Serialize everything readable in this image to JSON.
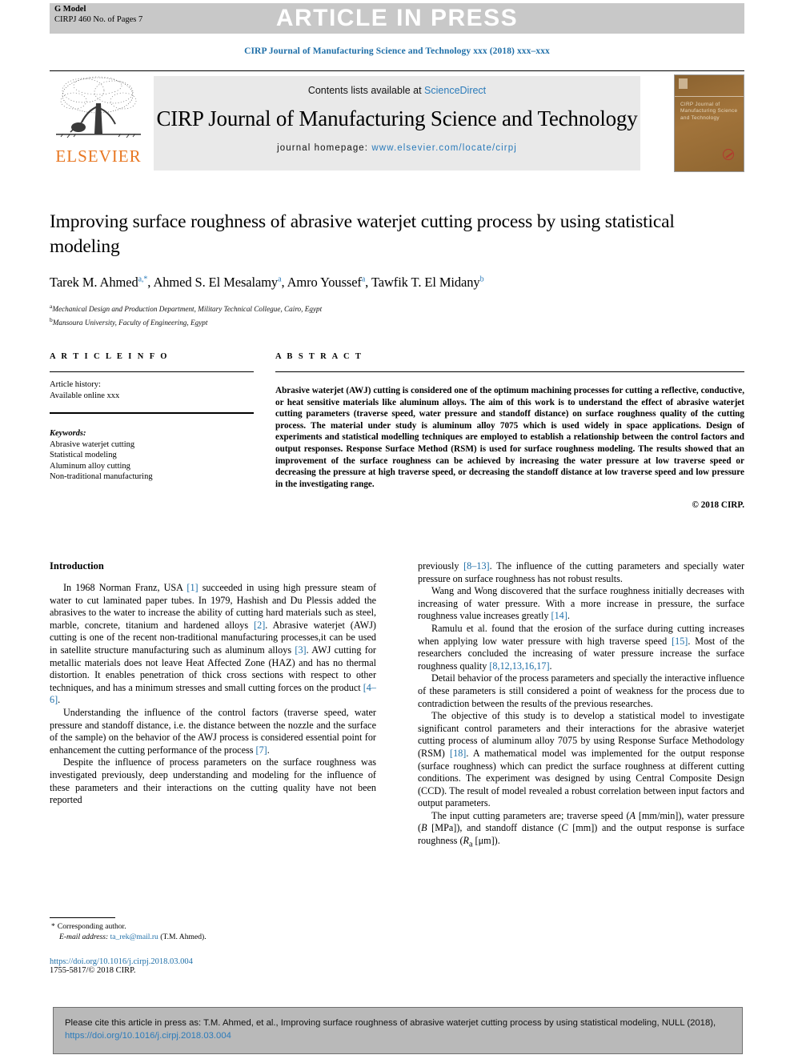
{
  "header": {
    "g_model_line1": "G Model",
    "g_model_line2": "CIRPJ 460 No. of Pages 7",
    "press_banner": "ARTICLE IN PRESS",
    "running_head": "CIRP Journal of Manufacturing Science and Technology xxx (2018) xxx–xxx",
    "accent_color": "#1f6fa8"
  },
  "masthead": {
    "contents_prefix": "Contents lists available at ",
    "contents_link": "ScienceDirect",
    "journal_title": "CIRP Journal of Manufacturing Science and Technology",
    "homepage_label": "journal homepage:",
    "homepage_url": "www.elsevier.com/locate/cirpj",
    "publisher_logo_text": "ELSEVIER",
    "publisher_logo_icon": "elsevier-tree-icon",
    "cover_title": "CIRP Journal of Manufacturing Science and Technology"
  },
  "article": {
    "title": "Improving surface roughness of abrasive waterjet cutting process by using statistical modeling",
    "affiliation_a": "Mechanical Design and Production Department, Military Technical Collegue, Cairo, Egypt",
    "affiliation_b": "Mansoura University, Faculty of Engineering, Egypt"
  },
  "info": {
    "heading": "A R T I C L E  I N F O",
    "history_label": "Article history:",
    "history_value": "Available online xxx",
    "keywords_label": "Keywords:",
    "keywords": [
      "Abrasive waterjet cutting",
      "Statistical modeling",
      "Aluminum alloy cutting",
      "Non-traditional manufacturing"
    ]
  },
  "abstract": {
    "heading": "A B S T R A C T",
    "text": "Abrasive waterjet (AWJ) cutting is considered one of the optimum machining processes for cutting a reflective, conductive, or heat sensitive materials like aluminum alloys. The aim of this work is to understand the effect of abrasive waterjet cutting parameters (traverse speed, water pressure and standoff distance) on surface roughness quality of the cutting process. The material under study is aluminum alloy 7075 which is used widely in space applications. Design of experiments and statistical modelling techniques are employed to establish a relationship between the control factors and output responses. Response Surface Method (RSM) is used for surface roughness modeling. The results showed that an improvement of the surface roughness can be achieved by increasing the water pressure at low traverse speed or decreasing the pressure at high traverse speed, or decreasing the standoff distance at low traverse speed and low pressure in the investigating range.",
    "copyright": "© 2018 CIRP."
  },
  "body": {
    "section_heading": "Introduction",
    "left_paragraphs": [
      "In 1968 Norman Franz, USA [1] succeeded in using high pressure steam of water to cut laminated paper tubes. In 1979, Hashish and Du Plessis added the abrasives to the water to increase the ability of cutting hard materials such as steel, marble, concrete, titanium and hardened alloys [2]. Abrasive waterjet (AWJ) cutting is one of the recent non-traditional manufacturing processes,it can be used in satellite structure manufacturing such as aluminum alloys [3]. AWJ cutting for metallic materials does not leave Heat Affected Zone (HAZ) and has no thermal distortion. It enables penetration of thick cross sections with respect to other techniques, and has a minimum stresses and small cutting forces on the product [4–6].",
      "Understanding the influence of the control factors (traverse speed, water pressure and standoff distance, i.e. the distance between the nozzle and the surface of the sample) on the behavior of the AWJ process is considered essential point for enhancement the cutting performance of the process [7].",
      "Despite the influence of process parameters on the surface roughness was investigated previously, deep understanding and modeling for the influence of these parameters and their interactions on the cutting quality have not been reported"
    ],
    "right_paragraphs": [
      "previously [8–13]. The influence of the cutting parameters and specially water pressure on surface roughness has not robust results.",
      "Wang and Wong discovered that the surface roughness initially decreases with increasing of water pressure. With a more increase in pressure, the surface roughness value increases greatly [14].",
      "Ramulu et al. found that the erosion of the surface during cutting increases when applying low water pressure with high traverse speed [15]. Most of the researchers concluded the increasing of water pressure increase the surface roughness quality [8,12,13,16,17].",
      "Detail behavior of the process parameters and specially the interactive influence of these parameters is still considered a point of weakness for the process due to contradiction between the results of the previous researches.",
      "The objective of this study is to develop a statistical model to investigate significant control parameters and their interactions for the abrasive waterjet cutting process of aluminum alloy 7075 by using Response Surface Methodology (RSM) [18]. A mathematical model was implemented for the output response (surface roughness) which can predict the surface roughness at different cutting conditions. The experiment was designed by using Central Composite Design (CCD). The result of model revealed a robust correlation between input factors and output parameters.",
      "The input cutting parameters are; traverse speed (A [mm/min]), water pressure (B [MPa]), and standoff distance (C [mm]) and the output response is surface roughness (Ra [μm])."
    ]
  },
  "footnote": {
    "corresponding_marker": "*",
    "corresponding_text": "Corresponding author.",
    "email_label": "E-mail address:",
    "email": "ta_rek@mail.ru",
    "email_owner": "(T.M. Ahmed).",
    "doi": "https://doi.org/10.1016/j.cirpj.2018.03.004",
    "issn_line": "1755-5817/© 2018 CIRP."
  },
  "citation_box": {
    "text_before_link": "Please cite this article in press as: T.M. Ahmed, et al., Improving surface roughness of abrasive waterjet cutting process by using statistical modeling, NULL (2018), ",
    "link": "https://doi.org/10.1016/j.cirpj.2018.03.004"
  }
}
